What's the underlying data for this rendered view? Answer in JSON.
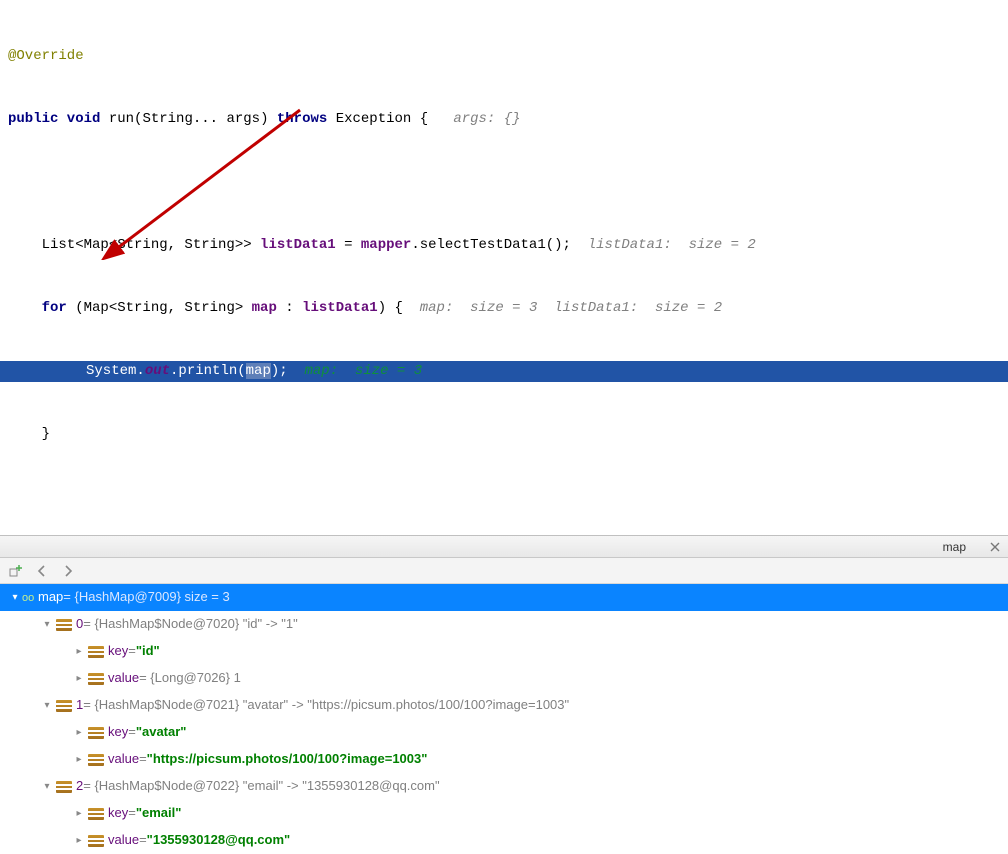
{
  "code": {
    "l1": "@Override",
    "l2a": "public void ",
    "l2b": "run",
    "l2c": "(String... args) ",
    "l2d": "throws ",
    "l2e": "Exception {   ",
    "l2f": "args: {}",
    "l3": "",
    "l4a": "    List<Map<String, String>> ",
    "l4b": "listData1",
    "l4c": " = ",
    "l4d": "mapper",
    "l4e": ".selectTestData1();  ",
    "l4f": "listData1:  size = 2 ",
    "l5a": "    for ",
    "l5b": "(Map<String, String> ",
    "l5c": "map",
    "l5d": " : ",
    "l5e": "listData1",
    "l5f": ") {  ",
    "l5g": "map:  size = 3  listData1:  size = 2",
    "l6a": "System.",
    "l6b": "out",
    "l6c": ".println(",
    "l6d": "map",
    "l6e": ");  ",
    "l6f": "map:  size = 3",
    "l7": "    }"
  },
  "debugger": {
    "tab": "map",
    "root": {
      "name": "map",
      "desc": " = {HashMap@7009}  size = 3"
    },
    "n0": {
      "idx": "0",
      "desc": " = {HashMap$Node@7020}  \"id\" -> \"1\"",
      "key": " = ",
      "keyv": "\"id\"",
      "val": " = {Long@7026} 1"
    },
    "n1": {
      "idx": "1",
      "desc": " = {HashMap$Node@7021}  \"avatar\" -> \"https://picsum.photos/100/100?image=1003\"",
      "key": " = ",
      "keyv": "\"avatar\"",
      "val": " = ",
      "valv": "\"https://picsum.photos/100/100?image=1003\""
    },
    "n2": {
      "idx": "2",
      "desc": " = {HashMap$Node@7022}  \"email\" -> \"1355930128@qq.com\"",
      "key": " = ",
      "keyv": "\"email\"",
      "val": " = ",
      "valv": "\"1355930128@qq.com\""
    },
    "labels": {
      "key": "key",
      "value": "value"
    }
  }
}
